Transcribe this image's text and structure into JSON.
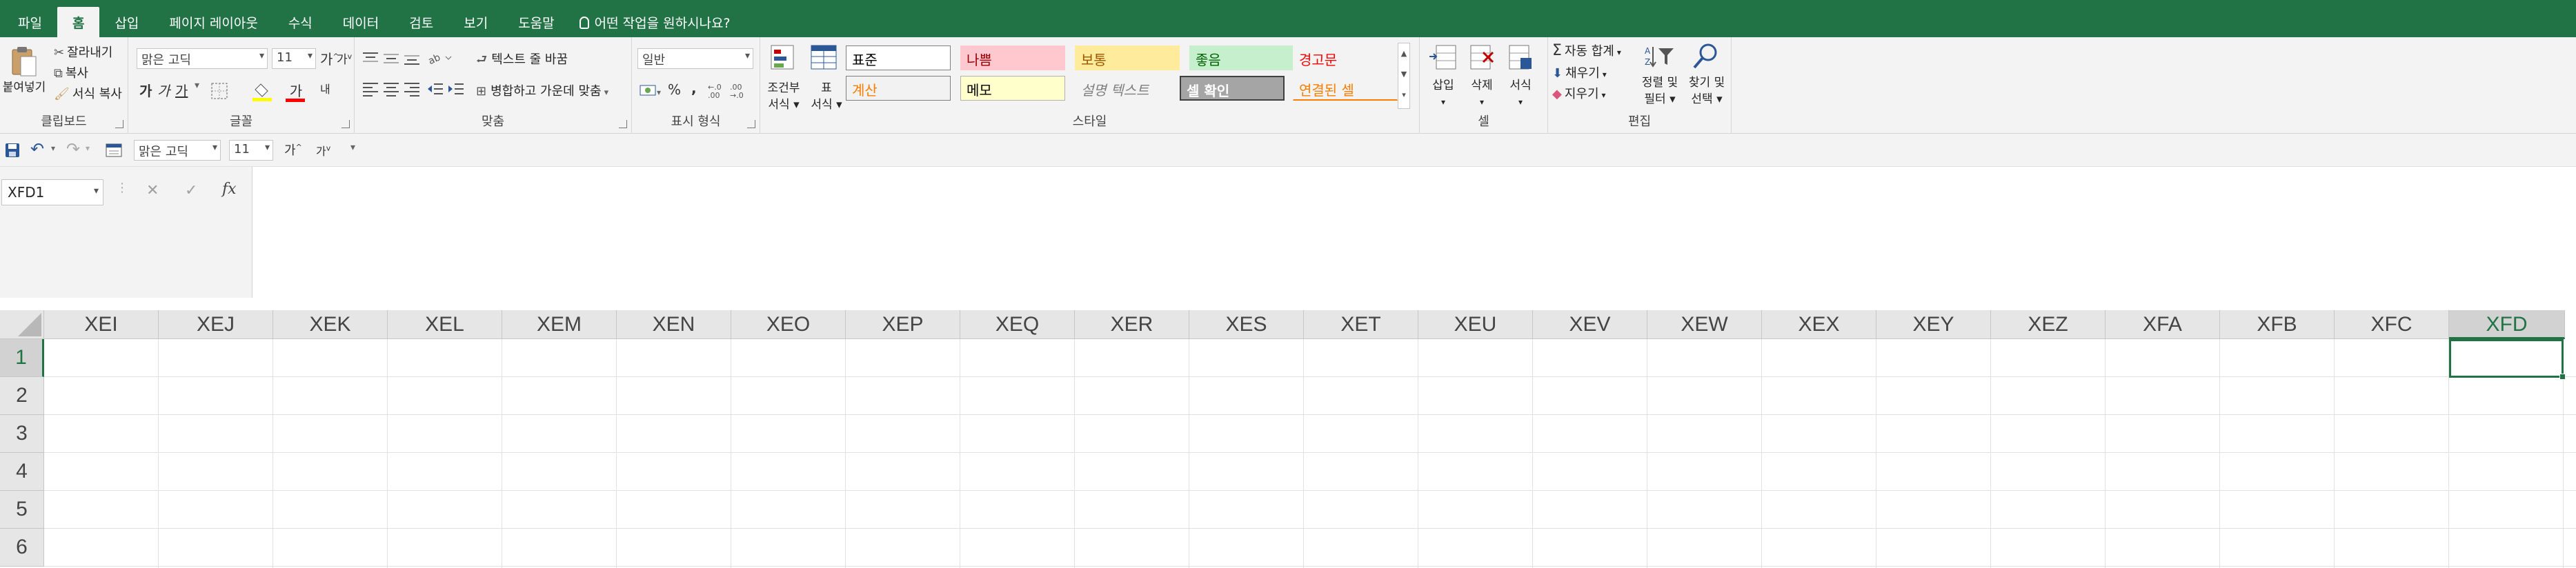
{
  "tabs": [
    {
      "label": "파일",
      "active": false
    },
    {
      "label": "홈",
      "active": true
    },
    {
      "label": "삽입",
      "active": false
    },
    {
      "label": "페이지 레이아웃",
      "active": false
    },
    {
      "label": "수식",
      "active": false
    },
    {
      "label": "데이터",
      "active": false
    },
    {
      "label": "검토",
      "active": false
    },
    {
      "label": "보기",
      "active": false
    },
    {
      "label": "도움말",
      "active": false
    }
  ],
  "tell_me": "어떤 작업을 원하시나요?",
  "clipboard": {
    "group_label": "클립보드",
    "paste": "붙여넣기",
    "cut": "잘라내기",
    "copy": "복사",
    "format_painter": "서식 복사"
  },
  "font": {
    "group_label": "글꼴",
    "font_name": "맑은 고딕",
    "font_size": "11",
    "grow": "가",
    "shrink": "가",
    "bold": "가",
    "italic": "가",
    "underline": "가",
    "font_color_glyph": "가",
    "phonetic": "내"
  },
  "alignment": {
    "group_label": "맞춤",
    "wrap_text": "텍스트 줄 바꿈",
    "merge_center": "병합하고 가운데 맞춤"
  },
  "number": {
    "group_label": "표시 형식",
    "format": "일반",
    "percent": "%",
    "comma": ","
  },
  "styles": {
    "group_label": "스타일",
    "conditional": "조건부",
    "conditional2": "서식",
    "table": "표",
    "table2": "서식",
    "cells": [
      {
        "label": "표준",
        "bg": "#ffffff",
        "fg": "#000000",
        "border": "#7f7f7f"
      },
      {
        "label": "나쁨",
        "bg": "#ffc7ce",
        "fg": "#9c0006",
        "border": "#ffc7ce"
      },
      {
        "label": "보통",
        "bg": "#ffeb9c",
        "fg": "#9c5700",
        "border": "#ffeb9c"
      },
      {
        "label": "좋음",
        "bg": "#c6efce",
        "fg": "#006100",
        "border": "#c6efce"
      },
      {
        "label": "경고문",
        "bg": "#f3f3f3",
        "fg": "#ff0000",
        "border": "#f3f3f3"
      },
      {
        "label": "계산",
        "bg": "#f2f2f2",
        "fg": "#fa7d00",
        "border": "#7f7f7f"
      },
      {
        "label": "메모",
        "bg": "#ffffcc",
        "fg": "#000000",
        "border": "#b2b2b2"
      },
      {
        "label": "설명 텍스트",
        "bg": "#f3f3f3",
        "fg": "#7f7f7f",
        "border": "#f3f3f3"
      },
      {
        "label": "셀 확인",
        "bg": "#a5a5a5",
        "fg": "#ffffff",
        "border": "#3f3f3f"
      },
      {
        "label": "연결된 셀",
        "bg": "#f3f3f3",
        "fg": "#fa7d00",
        "border": "#f3f3f3"
      }
    ]
  },
  "cells_group": {
    "group_label": "셀",
    "insert": "삽입",
    "delete": "삭제",
    "format": "서식"
  },
  "editing": {
    "group_label": "편집",
    "autosum": "자동 합계",
    "fill": "채우기",
    "clear": "지우기",
    "sort_filter": "정렬 및",
    "sort_filter2": "필터",
    "find_select": "찾기 및",
    "find_select2": "선택"
  },
  "qat": {
    "font_name": "맑은 고딕",
    "font_size": "11",
    "grow": "가",
    "shrink": "가"
  },
  "formula_bar": {
    "name_box": "XFD1",
    "cancel": "✕",
    "enter": "✓",
    "fx": "fx",
    "formula": ""
  },
  "grid": {
    "columns": [
      "XEI",
      "XEJ",
      "XEK",
      "XEL",
      "XEM",
      "XEN",
      "XEO",
      "XEP",
      "XEQ",
      "XER",
      "XES",
      "XET",
      "XEU",
      "XEV",
      "XEW",
      "XEX",
      "XEY",
      "XEZ",
      "XFA",
      "XFB",
      "XFC",
      "XFD"
    ],
    "selected_column": "XFD",
    "rows": [
      "1",
      "2",
      "3",
      "4",
      "5",
      "6"
    ],
    "selected_row": "1"
  },
  "colors": {
    "accent": "#217346"
  }
}
